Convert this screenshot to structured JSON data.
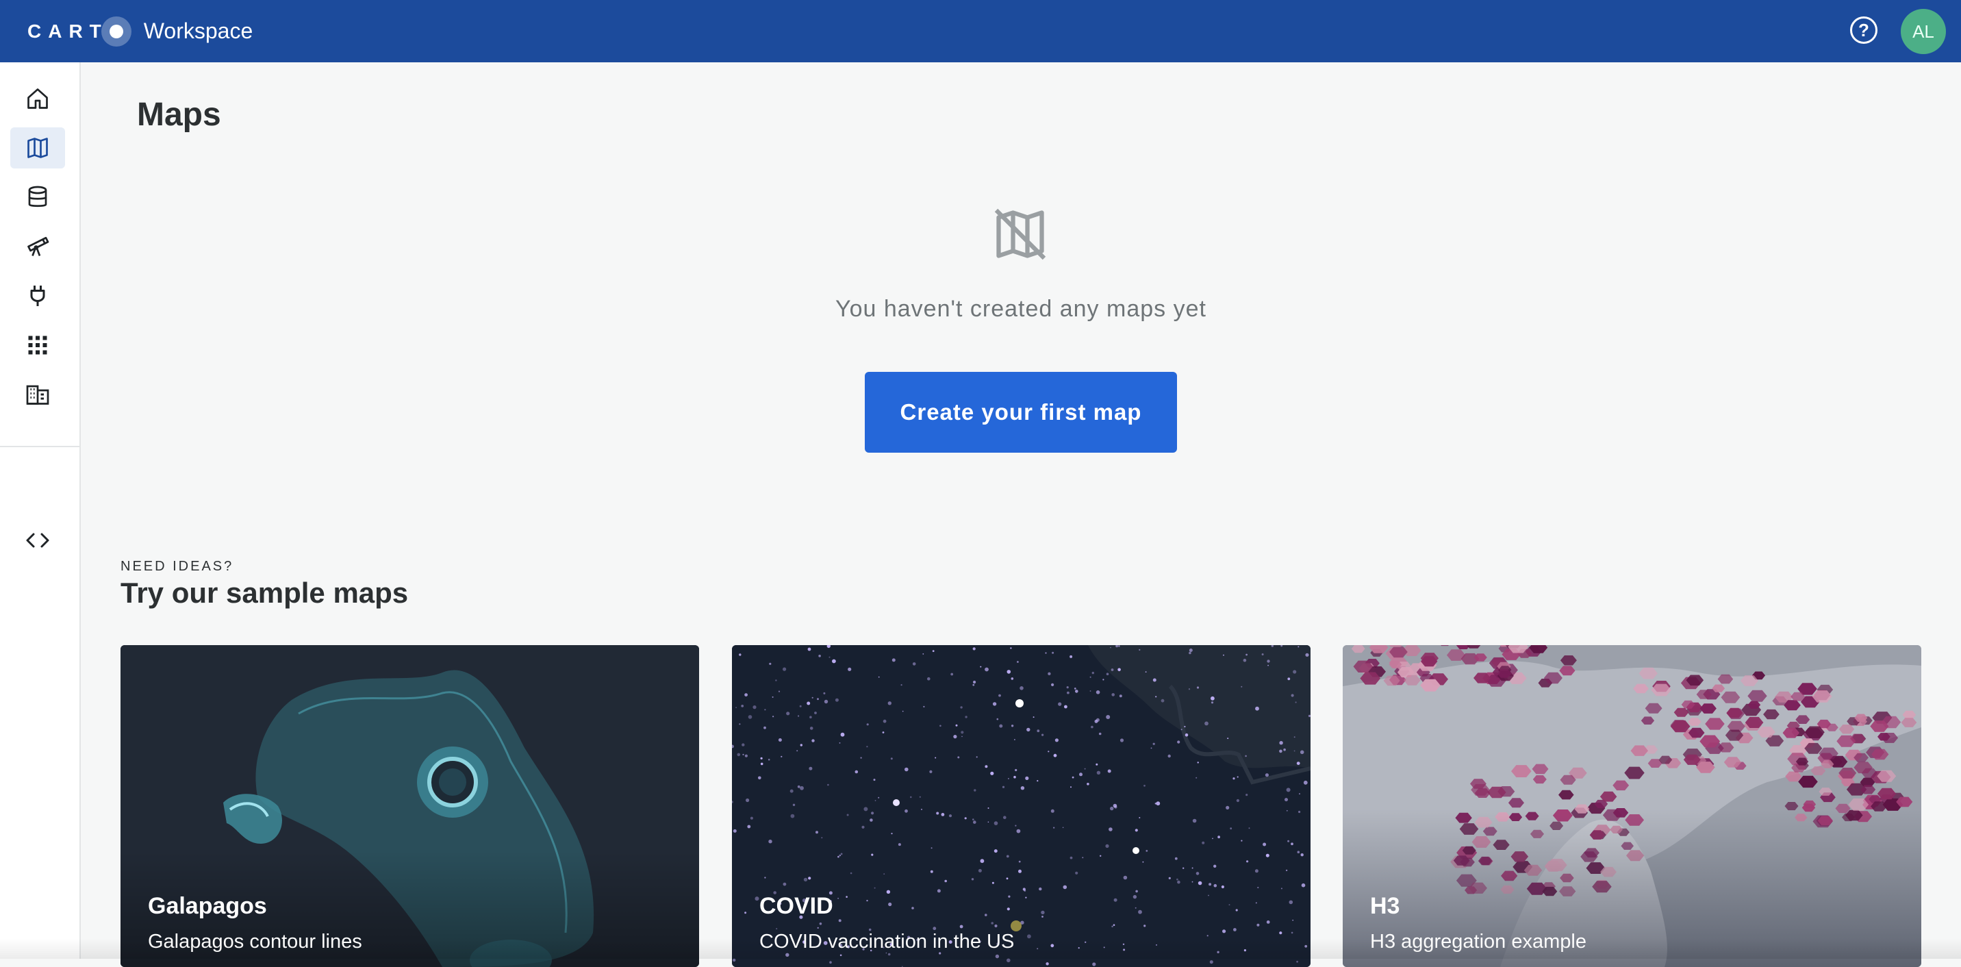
{
  "header": {
    "logo_text": "CART",
    "app_name": "Workspace",
    "help_icon": "help-circle-icon",
    "avatar_initials": "AL"
  },
  "sidebar": {
    "items": [
      {
        "name": "home",
        "icon": "home-icon",
        "active": false
      },
      {
        "name": "maps",
        "icon": "map-icon",
        "active": true
      },
      {
        "name": "data",
        "icon": "database-icon",
        "active": false
      },
      {
        "name": "data-observatory",
        "icon": "telescope-icon",
        "active": false
      },
      {
        "name": "connections",
        "icon": "plug-icon",
        "active": false
      },
      {
        "name": "applications",
        "icon": "grid-icon",
        "active": false
      },
      {
        "name": "organization",
        "icon": "building-icon",
        "active": false
      }
    ],
    "developers_icon": "code-icon"
  },
  "main": {
    "title": "Maps",
    "empty_state": {
      "icon": "map-off-icon",
      "message": "You haven't created any maps yet",
      "button_label": "Create your first map"
    },
    "samples": {
      "eyebrow": "NEED IDEAS?",
      "title": "Try our sample maps",
      "cards": [
        {
          "title": "Galapagos",
          "description": "Galapagos contour lines"
        },
        {
          "title": "COVID",
          "description": "COVID vaccination in the US"
        },
        {
          "title": "H3",
          "description": "H3 aggregation example"
        }
      ]
    }
  },
  "colors": {
    "topbar": "#1c4b9c",
    "primary_button": "#2567d9",
    "avatar": "#4caf87",
    "background": "#f6f7f7"
  }
}
